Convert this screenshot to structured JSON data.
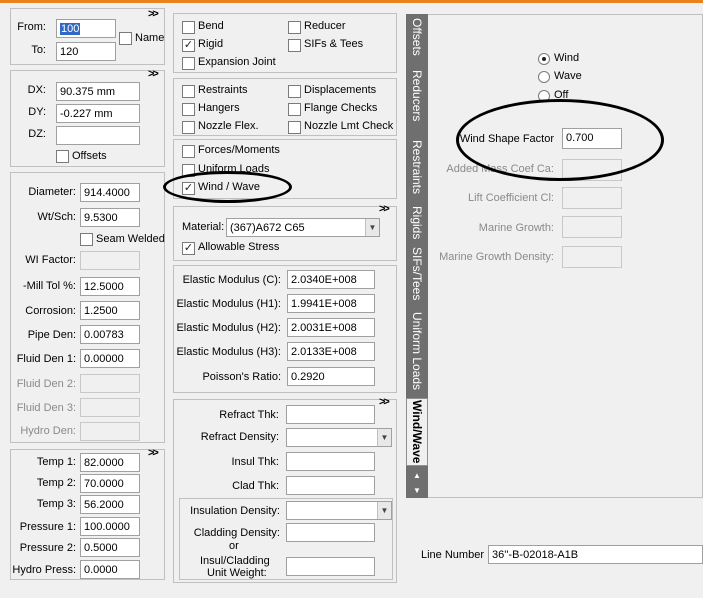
{
  "top": {
    "from_label": "From:",
    "from_value": "100",
    "to_label": "To:",
    "to_value": "120",
    "name_label": "Name"
  },
  "delta": {
    "dx_label": "DX:",
    "dx_value": "90.375 mm",
    "dy_label": "DY:",
    "dy_value": "-0.227 mm",
    "dz_label": "DZ:",
    "dz_value": "",
    "offsets_label": "Offsets"
  },
  "pipe": {
    "diameter_label": "Diameter:",
    "diameter_value": "914.4000",
    "wtsch_label": "Wt/Sch:",
    "wtsch_value": "9.5300",
    "seam_label": "Seam Welded",
    "wi_label": "WI Factor:",
    "mill_label": "-Mill Tol %:",
    "mill_value": "12.5000",
    "corrosion_label": "Corrosion:",
    "corrosion_value": "1.2500",
    "pipeden_label": "Pipe Den:",
    "pipeden_value": "0.00783",
    "fluid1_label": "Fluid Den 1:",
    "fluid1_value": "0.00000",
    "fluid2_label": "Fluid Den 2:",
    "fluid3_label": "Fluid Den 3:",
    "hydro_label": "Hydro Den:"
  },
  "temps": {
    "t1_label": "Temp 1:",
    "t1_value": "82.0000",
    "t2_label": "Temp 2:",
    "t2_value": "70.0000",
    "t3_label": "Temp 3:",
    "t3_value": "56.2000",
    "p1_label": "Pressure 1:",
    "p1_value": "100.0000",
    "p2_label": "Pressure 2:",
    "p2_value": "0.5000",
    "hp_label": "Hydro Press:",
    "hp_value": "0.0000"
  },
  "checks": {
    "bend": "Bend",
    "reducer": "Reducer",
    "rigid": "Rigid",
    "sifs": "SIFs & Tees",
    "expansion": "Expansion Joint",
    "restraints": "Restraints",
    "displacements": "Displacements",
    "hangers": "Hangers",
    "flange": "Flange Checks",
    "nozzle_flex": "Nozzle Flex.",
    "nozzle_lmt": "Nozzle Lmt Check",
    "forces": "Forces/Moments",
    "uniform": "Uniform Loads",
    "wind_wave": "Wind / Wave",
    "check_mark": "✓"
  },
  "material": {
    "label": "Material:",
    "value": "(367)A672 C65",
    "allowable": "Allowable Stress"
  },
  "elastic": {
    "c_label": "Elastic Modulus (C):",
    "c_value": "2.0340E+008",
    "h1_label": "Elastic Modulus (H1):",
    "h1_value": "1.9941E+008",
    "h2_label": "Elastic Modulus (H2):",
    "h2_value": "2.0031E+008",
    "h3_label": "Elastic Modulus (H3):",
    "h3_value": "2.0133E+008",
    "poisson_label": "Poisson's Ratio:",
    "poisson_value": "0.2920"
  },
  "refract": {
    "thk_label": "Refract Thk:",
    "density_label": "Refract Density:",
    "insul_label": "Insul Thk:",
    "clad_label": "Clad Thk:",
    "insul_density_label": "Insulation Density:",
    "cladding_density_label": "Cladding Density:",
    "or_label": "or",
    "unit_weight_label1": "Insul/Cladding",
    "unit_weight_label2": "Unit Weight:"
  },
  "tabs": [
    "Offsets",
    "Reducers",
    "Restraints",
    "Rigids",
    "SIFs/Tees",
    "Uniform Loads",
    "Wind/Wave"
  ],
  "wind": {
    "radio_wind": "Wind",
    "radio_wave": "Wave",
    "radio_off": "Off",
    "shape_label": "Wind Shape Factor",
    "shape_value": "0.700",
    "added_mass_label": "Added Mass Coef Ca:",
    "lift_label": "Lift Coefficient Cl:",
    "marine_label": "Marine Growth:",
    "marine_density_label": "Marine Growth Density:"
  },
  "line": {
    "label": "Line Number :",
    "value": "36''-B-02018-A1B"
  },
  "ui": {
    "expand": ">>",
    "arrow_up": "▲",
    "arrow_down": "▼",
    "dd_arrow": "▼"
  }
}
